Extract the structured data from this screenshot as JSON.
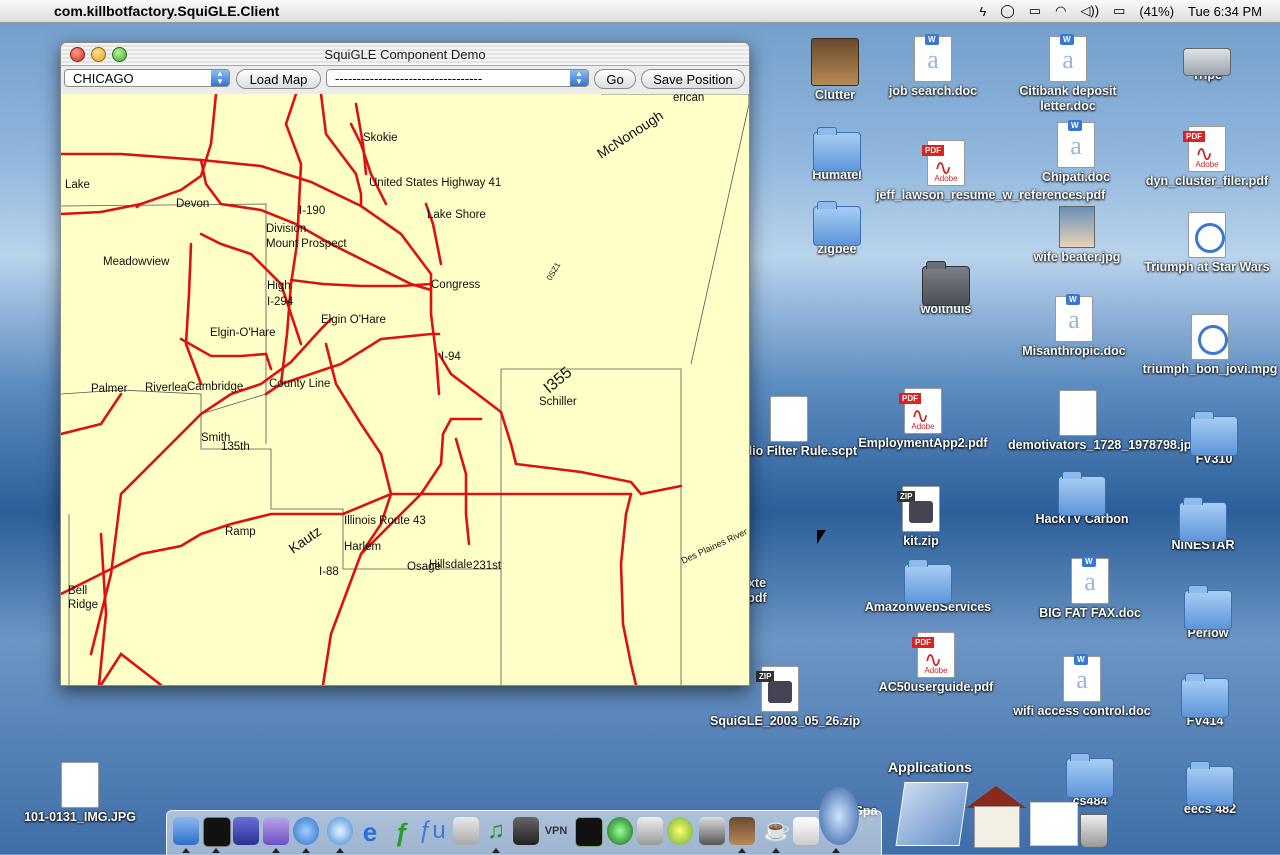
{
  "menubar": {
    "app_name": "com.killbotfactory.SquiGLE.Client",
    "battery": "(41%)",
    "clock": "Tue 6:34 PM"
  },
  "window": {
    "title": "SquiGLE Component Demo",
    "city_select": "CHICAGO",
    "load_map": "Load Map",
    "position_select": "----------------------------------",
    "go": "Go",
    "save_position": "Save Position"
  },
  "map": {
    "labels": [
      "Skokie",
      "McNonough",
      "erican",
      "Lake",
      "Devon",
      "United States Highway 41",
      "I-190",
      "Lake Shore",
      "Division",
      "Mount Prospect",
      "Meadowview",
      "0SZ1",
      "High",
      "Congress",
      "I-294",
      "Elgin O'Hare",
      "Elgin-O'Hare",
      "I-94",
      "Palmer",
      "Riverlea",
      "Cambridge",
      "County Line",
      "I355",
      "Schiller",
      "Smith",
      "135th",
      "Ramp",
      "Illinois Route 43",
      "Kautz",
      "Harlem",
      "I-88",
      "Osage",
      "Hillsdale",
      "231st",
      "Bell",
      "Ridge",
      "Des Plaines River"
    ]
  },
  "desktop": {
    "icons": [
      {
        "label": "Clutter"
      },
      {
        "label": "job search.doc"
      },
      {
        "label": "Citibank deposit letter.doc"
      },
      {
        "label": "Tripe"
      },
      {
        "label": "Humatel"
      },
      {
        "label": "jeff_lawson_resume_w_references.pdf"
      },
      {
        "label": "Chipati.doc"
      },
      {
        "label": "dyn_cluster_filer.pdf"
      },
      {
        "label": "zigbee"
      },
      {
        "label": "wife beater.jpg"
      },
      {
        "label": "Triumph at Star Wars"
      },
      {
        "label": "wolthuis"
      },
      {
        "label": "Misanthropic.doc"
      },
      {
        "label": "triumph_bon_jovi.mpg"
      },
      {
        "label": "mHolio Filter Rule.scpt"
      },
      {
        "label": "EmploymentApp2.pdf"
      },
      {
        "label": "demotivators_1728_1978798.jpg"
      },
      {
        "label": "FV310"
      },
      {
        "label": "HackTV Carbon"
      },
      {
        "label": "kit.zip"
      },
      {
        "label": "NINESTAR"
      },
      {
        "label": "AmazonWebServices"
      },
      {
        "label": "BIG FAT FAX.doc"
      },
      {
        "label": "Perlow"
      },
      {
        "label": "AC50userguide.pdf"
      },
      {
        "label": "wifi access control.doc"
      },
      {
        "label": "FV414"
      },
      {
        "label": "SquiGLE_2003_05_26.zip"
      },
      {
        "label": "Applications"
      },
      {
        "label": "101-0131_IMG.JPG"
      },
      {
        "label": "eecs 482"
      },
      {
        "label": "xte pdf"
      },
      {
        "label": "Spa"
      },
      {
        "label": "cs484"
      }
    ]
  },
  "dock": {
    "items": [
      "Finder",
      "Terminal",
      "Mozilla",
      "Mail",
      "iChat",
      "Safari",
      "Internet Explorer",
      "Fetch",
      "Font",
      "Calculator",
      "iTunes",
      "iMovie",
      "VPN",
      "Activity",
      "Network",
      "System",
      "Xcode",
      "Classic",
      "Clutter",
      "Java",
      "TextEdit",
      "Preview",
      "Applications",
      "Home",
      "Desktop",
      "Trash"
    ]
  },
  "colors": {
    "map_background": "#ffffc8",
    "road": "#dd1111",
    "boundary": "#555555"
  }
}
